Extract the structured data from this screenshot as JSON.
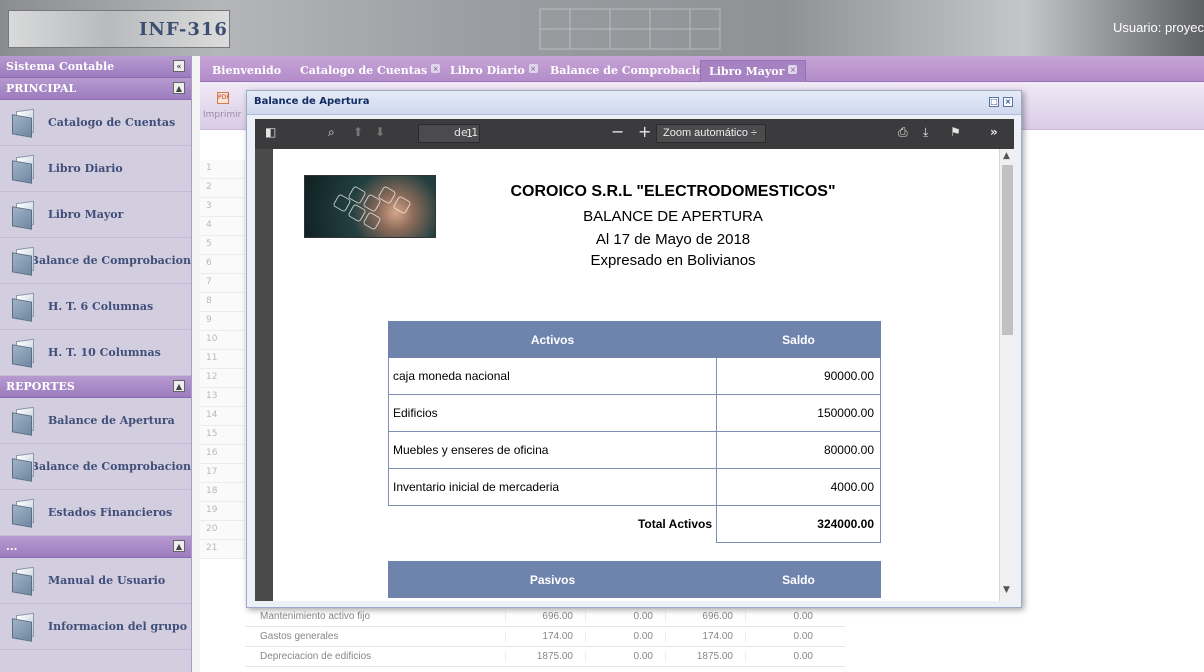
{
  "header": {
    "logo": "INF-316",
    "user_label": "Usuario: proyec"
  },
  "sidebar": {
    "system_title": "Sistema Contable",
    "sections": [
      {
        "title": "PRINCIPAL",
        "items": [
          "Catalogo de Cuentas",
          "Libro Diario",
          "Libro Mayor",
          "Balance de Comprobacion",
          "H. T. 6 Columnas",
          "H. T. 10 Columnas"
        ]
      },
      {
        "title": "REPORTES",
        "items": [
          "Balance de Apertura",
          "Balance de Comprobacion",
          "Estados Financieros"
        ]
      },
      {
        "title": "...",
        "items": [
          "Manual de Usuario",
          "Informacion del grupo"
        ]
      }
    ]
  },
  "tabs": [
    {
      "label": "Bienvenido",
      "closable": false
    },
    {
      "label": "Catalogo de Cuentas",
      "closable": true
    },
    {
      "label": "Libro Diario",
      "closable": true
    },
    {
      "label": "Balance de Comprobacion",
      "closable": true
    },
    {
      "label": "Libro Mayor",
      "closable": true
    }
  ],
  "background": {
    "print_label": "Imprimir",
    "row_numbers": [
      "1",
      "2",
      "3",
      "4",
      "5",
      "6",
      "7",
      "8",
      "9",
      "10",
      "11",
      "12",
      "13",
      "14",
      "15",
      "16",
      "17",
      "18",
      "19",
      "20",
      "21"
    ],
    "rows": [
      {
        "name": "Mantenimiento activo fijo",
        "cols": [
          "696.00",
          "0.00",
          "696.00",
          "0.00"
        ]
      },
      {
        "name": "Gastos generales",
        "cols": [
          "174.00",
          "0.00",
          "174.00",
          "0.00"
        ]
      },
      {
        "name": "Depreciacion de edificios",
        "cols": [
          "1875.00",
          "0.00",
          "1875.00",
          "0.00"
        ]
      }
    ]
  },
  "dialog": {
    "title": "Balance de Apertura",
    "pdf": {
      "page_current": "1",
      "page_total": "de 1",
      "zoom": "Zoom automático",
      "company": "COROICO S.R.L \"ELECTRODOMESTICOS\"",
      "report_title": "BALANCE DE APERTURA",
      "date_line": "Al 17 de Mayo de 2018",
      "currency_line": "Expresado en Bolivianos",
      "activos_header": "Activos",
      "saldo_header": "Saldo",
      "activos": [
        {
          "name": "caja moneda nacional",
          "saldo": "90000.00"
        },
        {
          "name": "Edificios",
          "saldo": "150000.00"
        },
        {
          "name": "Muebles y enseres de oficina",
          "saldo": "80000.00"
        },
        {
          "name": "Inventario inicial de mercaderia",
          "saldo": "4000.00"
        }
      ],
      "total_activos_label": "Total Activos",
      "total_activos": "324000.00",
      "pasivos_header": "Pasivos",
      "pasivos_saldo_header": "Saldo"
    }
  }
}
